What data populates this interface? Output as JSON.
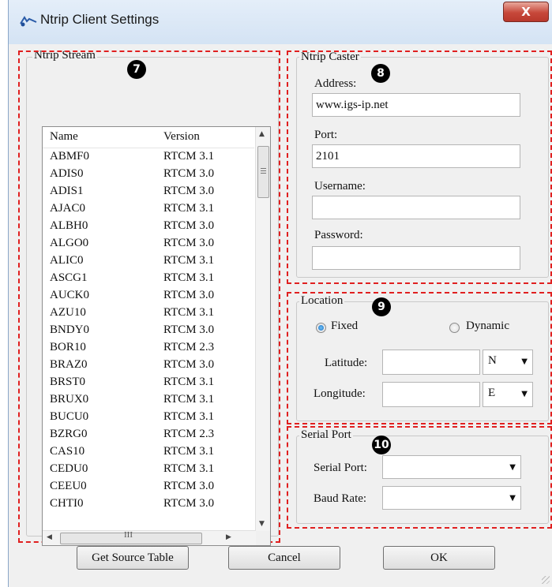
{
  "window": {
    "title": "Ntrip Client Settings",
    "close_symbol": "X"
  },
  "stream": {
    "legend": "Ntrip Stream",
    "badge": "7",
    "columns": [
      "Name",
      "Version"
    ],
    "rows": [
      [
        "ABMF0",
        "RTCM 3.1"
      ],
      [
        "ADIS0",
        "RTCM 3.0"
      ],
      [
        "ADIS1",
        "RTCM 3.0"
      ],
      [
        "AJAC0",
        "RTCM 3.1"
      ],
      [
        "ALBH0",
        "RTCM 3.0"
      ],
      [
        "ALGO0",
        "RTCM 3.0"
      ],
      [
        "ALIC0",
        "RTCM 3.1"
      ],
      [
        "ASCG1",
        "RTCM 3.1"
      ],
      [
        "AUCK0",
        "RTCM 3.0"
      ],
      [
        "AZU10",
        "RTCM 3.1"
      ],
      [
        "BNDY0",
        "RTCM 3.0"
      ],
      [
        "BOR10",
        "RTCM 2.3"
      ],
      [
        "BRAZ0",
        "RTCM 3.0"
      ],
      [
        "BRST0",
        "RTCM 3.1"
      ],
      [
        "BRUX0",
        "RTCM 3.1"
      ],
      [
        "BUCU0",
        "RTCM 3.1"
      ],
      [
        "BZRG0",
        "RTCM 2.3"
      ],
      [
        "CAS10",
        "RTCM 3.1"
      ],
      [
        "CEDU0",
        "RTCM 3.1"
      ],
      [
        "CEEU0",
        "RTCM 3.0"
      ],
      [
        "CHTI0",
        "RTCM 3.0"
      ]
    ],
    "hscroll_grip": "III"
  },
  "caster": {
    "legend": "Ntrip Caster",
    "badge": "8",
    "address_label": "Address:",
    "address_value": "www.igs-ip.net",
    "port_label": "Port:",
    "port_value": "2101",
    "username_label": "Username:",
    "username_value": "",
    "password_label": "Password:",
    "password_value": ""
  },
  "location": {
    "legend": "Location",
    "badge": "9",
    "fixed_label": "Fixed",
    "dynamic_label": "Dynamic",
    "selected": "Fixed",
    "latitude_label": "Latitude:",
    "latitude_value": "",
    "lat_hemisphere": "N",
    "longitude_label": "Longitude:",
    "longitude_value": "",
    "lon_hemisphere": "E"
  },
  "serial": {
    "legend": "Serial Port",
    "badge": "10",
    "port_label": "Serial Port:",
    "port_value": "",
    "baud_label": "Baud Rate:",
    "baud_value": ""
  },
  "buttons": {
    "get_source": "Get Source Table",
    "cancel": "Cancel",
    "ok": "OK"
  },
  "icons": {
    "app": "ntrip-app-icon",
    "dropdown": "▼",
    "scroll_up": "▲",
    "scroll_down": "▼",
    "scroll_left": "◀",
    "scroll_right": "▶"
  },
  "colors": {
    "highlight_dash": "#e02020",
    "titlebar": "#d4e3f4",
    "close": "#c7483a"
  }
}
